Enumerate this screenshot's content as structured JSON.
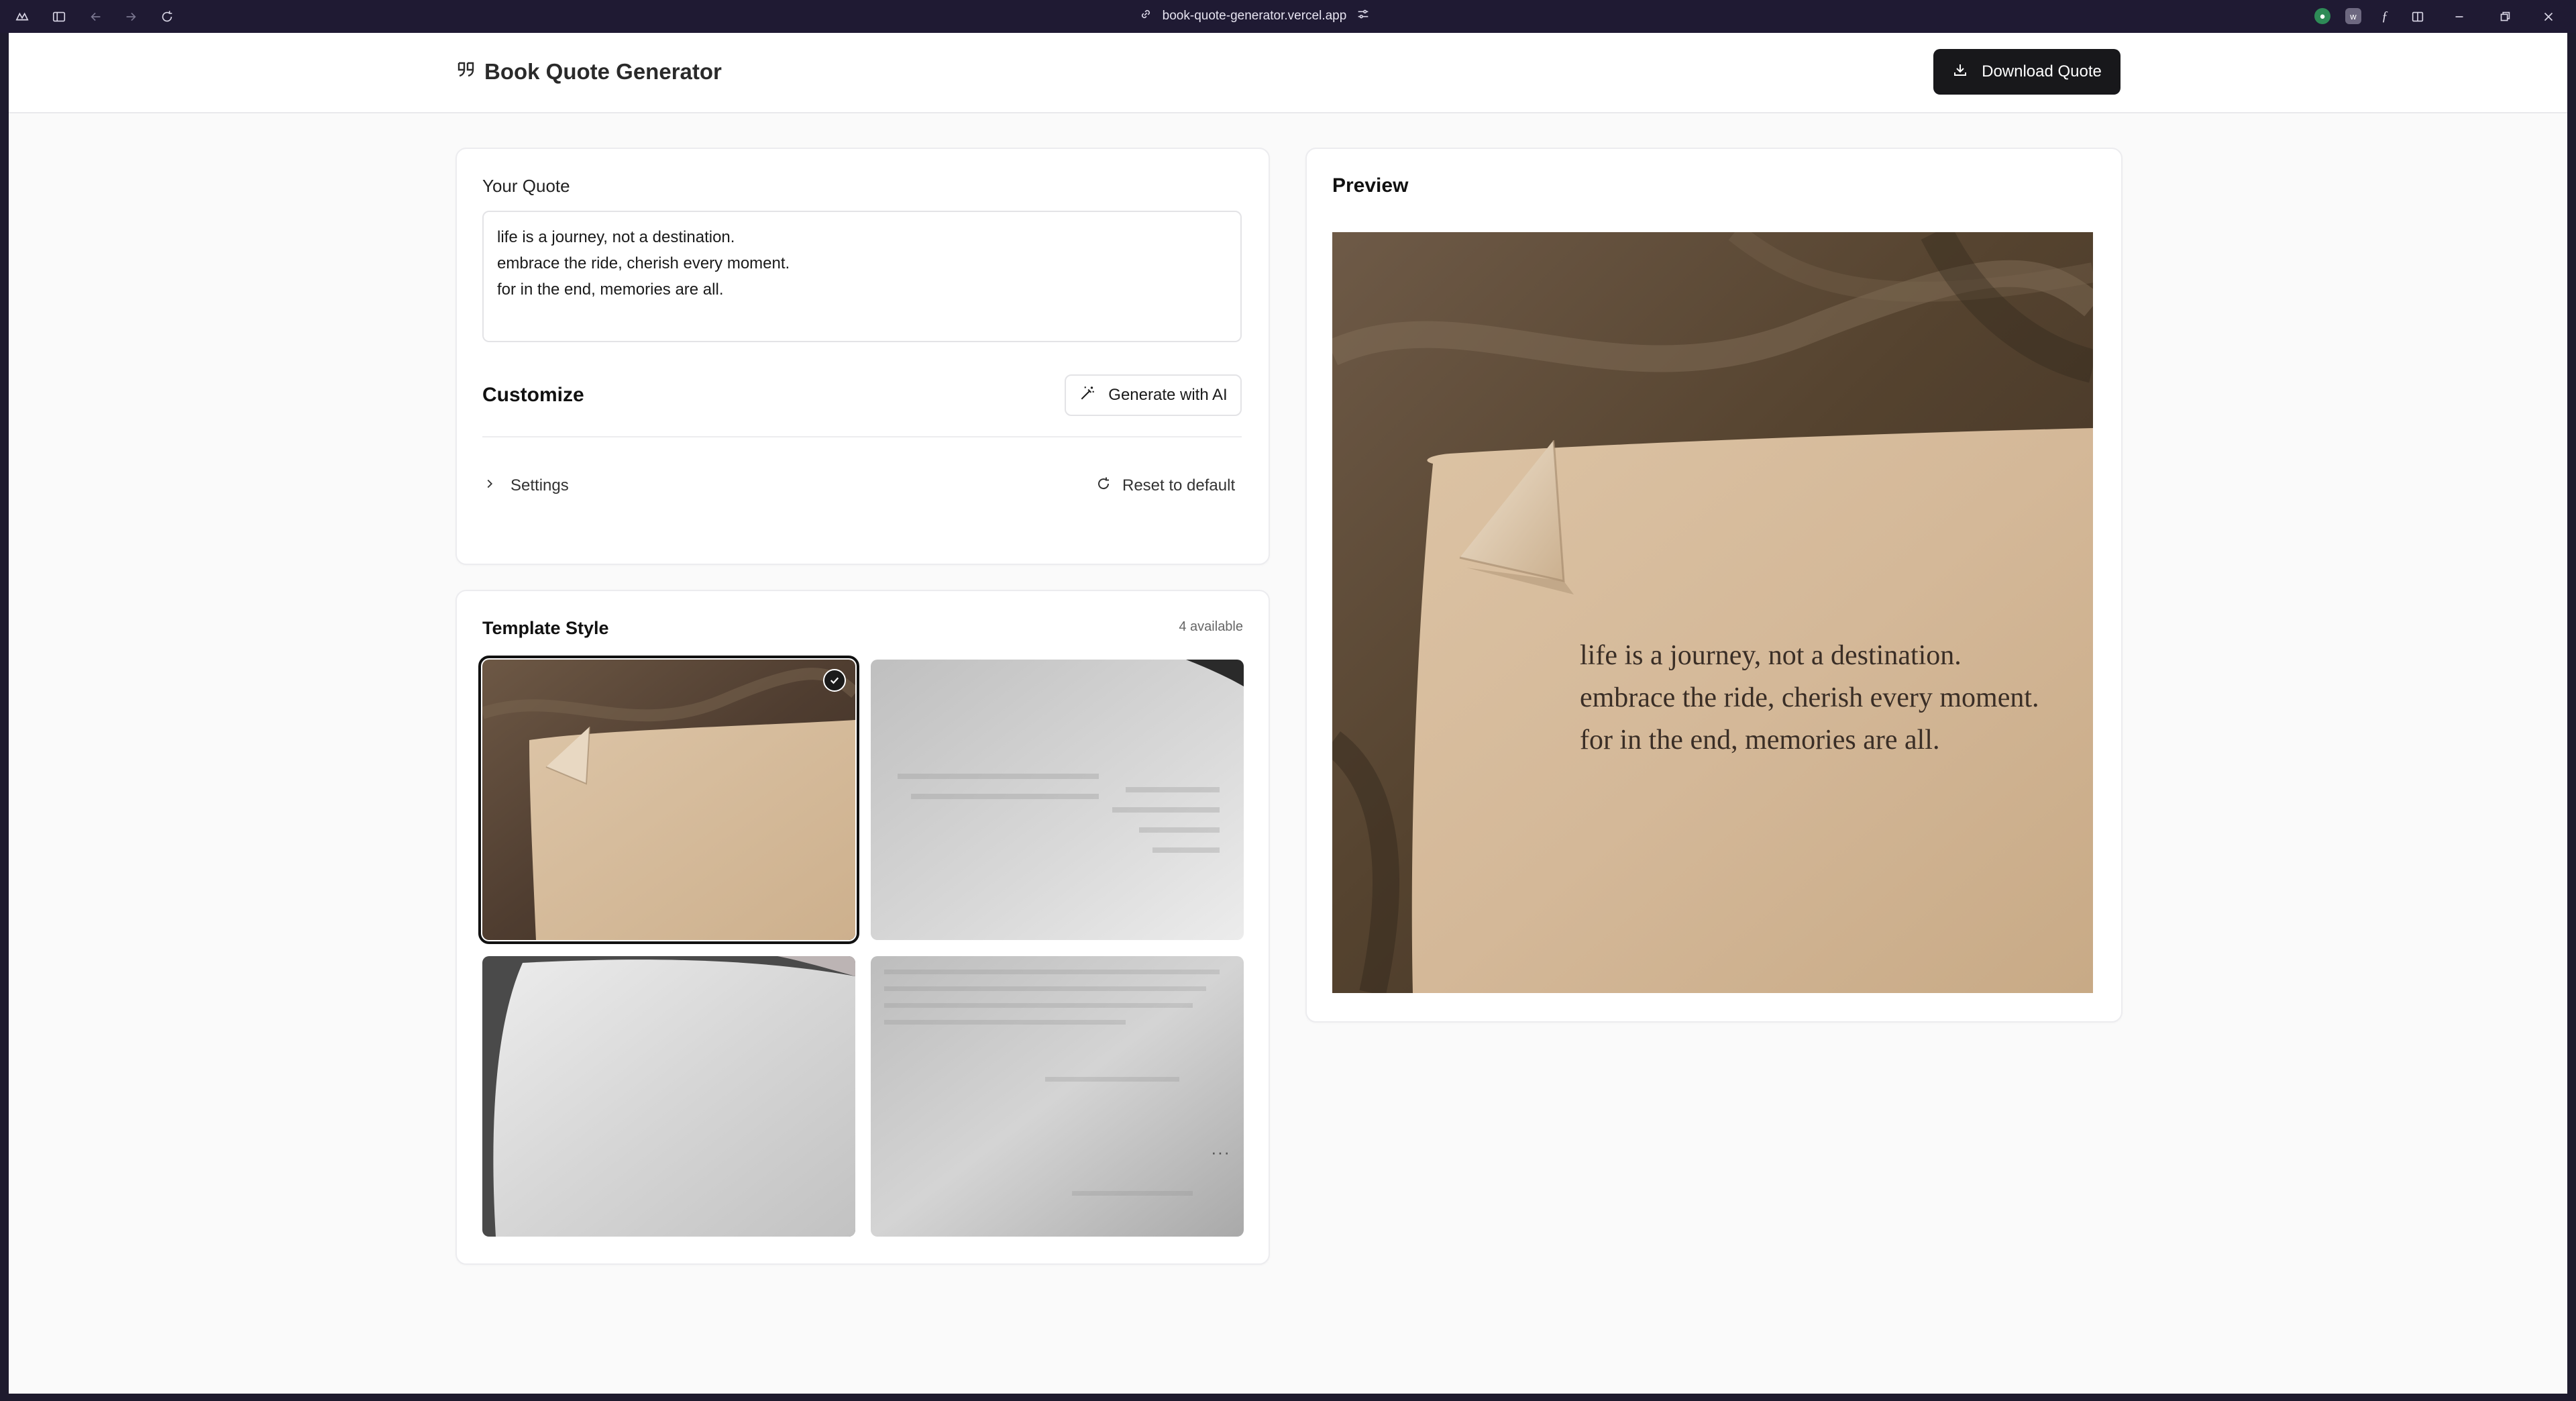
{
  "browser": {
    "url": "book-quote-generator.vercel.app"
  },
  "header": {
    "app_title": "Book Quote Generator",
    "download_label": "Download Quote"
  },
  "quote": {
    "label": "Your Quote",
    "lines": [
      "life is a journey, not a destination.",
      "embrace the ride, cherish every moment.",
      "for in the end, memories are all."
    ]
  },
  "customize": {
    "title": "Customize",
    "generate_label": "Generate with AI",
    "settings_label": "Settings",
    "reset_label": "Reset to default"
  },
  "templates": {
    "title": "Template Style",
    "available": "4 available",
    "selected_index": 0,
    "items": [
      {
        "name": "crumpled-page-on-fabric",
        "selected": true
      },
      {
        "name": "blurred-book-page",
        "selected": false
      },
      {
        "name": "white-book-page",
        "selected": false
      },
      {
        "name": "grey-faded-page",
        "selected": false
      }
    ]
  },
  "preview": {
    "title": "Preview"
  },
  "colors": {
    "accent": "#18181b",
    "chrome_bg": "#1f1a33",
    "page_bg": "#fafafa",
    "paper": "#d9bfa0",
    "fabric": "#5c4838"
  }
}
